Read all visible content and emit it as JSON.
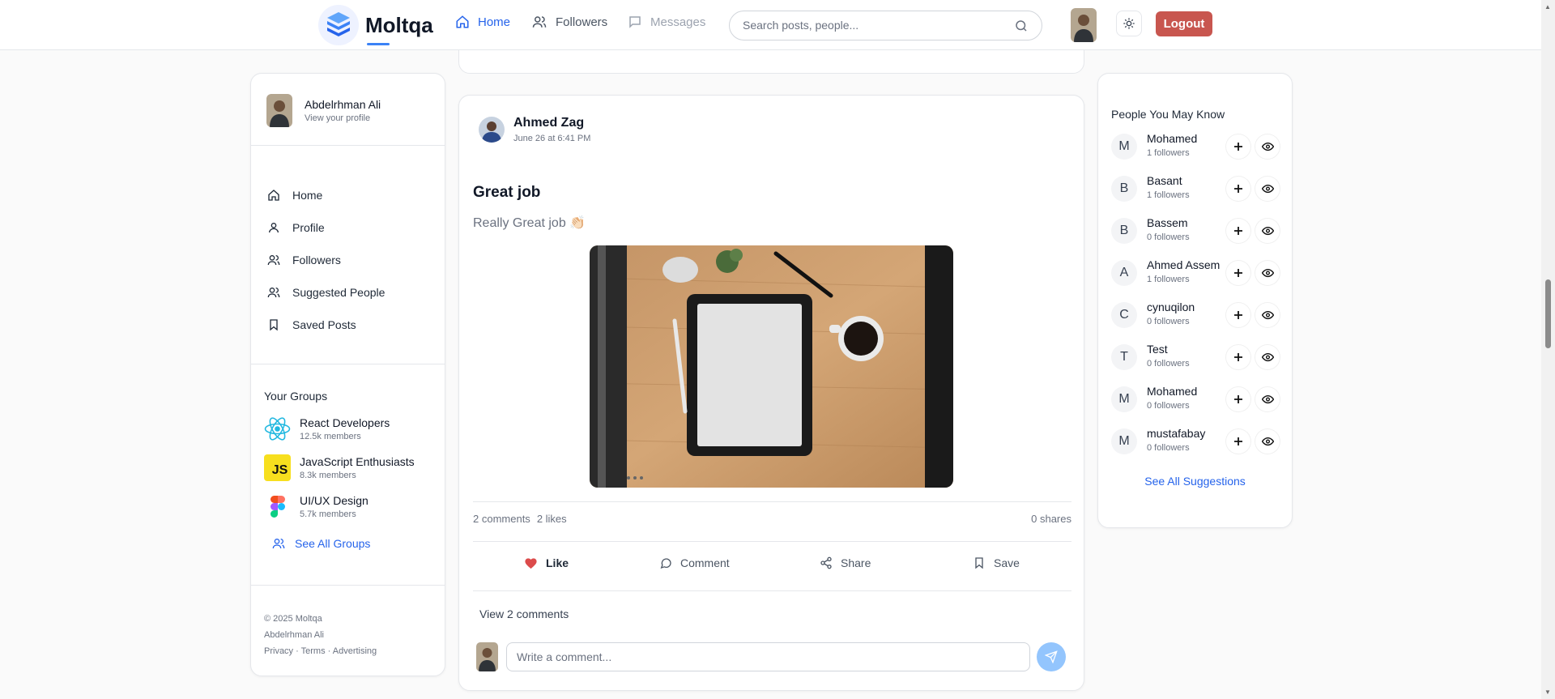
{
  "brand": {
    "name": "Moltqa"
  },
  "nav": {
    "home": "Home",
    "followers": "Followers",
    "messages": "Messages",
    "search_placeholder": "Search posts, people...",
    "logout": "Logout"
  },
  "sidebar": {
    "profile_name": "Abdelrhman Ali",
    "profile_sub": "View your profile",
    "items": [
      {
        "label": "Home",
        "icon": "home-icon"
      },
      {
        "label": "Profile",
        "icon": "user-icon"
      },
      {
        "label": "Followers",
        "icon": "users-icon"
      },
      {
        "label": "Suggested People",
        "icon": "users-icon"
      },
      {
        "label": "Saved Posts",
        "icon": "bookmark-icon"
      }
    ],
    "groups_title": "Your Groups",
    "groups": [
      {
        "name": "React Developers",
        "members": "12.5k members",
        "icon": "react-icon"
      },
      {
        "name": "JavaScript Enthusiasts",
        "members": "8.3k members",
        "icon": "js-icon",
        "icon_text": "JS"
      },
      {
        "name": "UI/UX Design",
        "members": "5.7k members",
        "icon": "figma-icon"
      }
    ],
    "see_all_groups": "See All Groups",
    "footer": {
      "copyright": "© 2025 Moltqa",
      "author": "Abdelrhman Ali",
      "links": "Privacy · Terms · Advertising"
    }
  },
  "post": {
    "author": "Ahmed Zag",
    "time": "June 26 at 6:41 PM",
    "title": "Great job",
    "body": "Really Great job 👏🏻",
    "image_alt": "tablet on wooden desk with coffee",
    "comments_count": "2 comments",
    "likes_count": "2 likes",
    "shares_count": "0 shares",
    "actions": {
      "like": "Like",
      "comment": "Comment",
      "share": "Share",
      "save": "Save"
    },
    "view_comments": "View 2 comments",
    "comment_placeholder": "Write a comment..."
  },
  "suggestions": {
    "title": "People You May Know",
    "people": [
      {
        "initial": "M",
        "name": "Mohamed",
        "followers": "1 followers"
      },
      {
        "initial": "B",
        "name": "Basant",
        "followers": "1 followers"
      },
      {
        "initial": "B",
        "name": "Bassem",
        "followers": "0 followers"
      },
      {
        "initial": "A",
        "name": "Ahmed Assem",
        "followers": "1 followers"
      },
      {
        "initial": "C",
        "name": "cynuqilon",
        "followers": "0 followers"
      },
      {
        "initial": "T",
        "name": "Test",
        "followers": "0 followers"
      },
      {
        "initial": "M",
        "name": "Mohamed",
        "followers": "0 followers"
      },
      {
        "initial": "M",
        "name": "mustafabay",
        "followers": "0 followers"
      }
    ],
    "see_all": "See All Suggestions"
  },
  "colors": {
    "accent": "#2563eb",
    "logout": "#c8564f",
    "like": "#dc4b4b",
    "send": "#93c5fd"
  }
}
